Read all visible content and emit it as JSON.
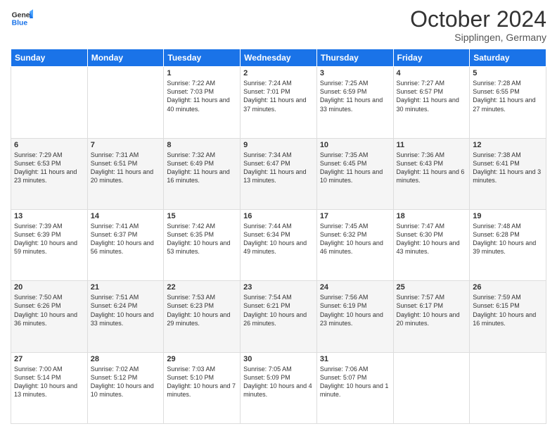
{
  "header": {
    "logo_general": "General",
    "logo_blue": "Blue",
    "month": "October 2024",
    "location": "Sipplingen, Germany"
  },
  "days_of_week": [
    "Sunday",
    "Monday",
    "Tuesday",
    "Wednesday",
    "Thursday",
    "Friday",
    "Saturday"
  ],
  "weeks": [
    [
      {
        "day": "",
        "sunrise": "",
        "sunset": "",
        "daylight": ""
      },
      {
        "day": "",
        "sunrise": "",
        "sunset": "",
        "daylight": ""
      },
      {
        "day": "1",
        "sunrise": "Sunrise: 7:22 AM",
        "sunset": "Sunset: 7:03 PM",
        "daylight": "Daylight: 11 hours and 40 minutes."
      },
      {
        "day": "2",
        "sunrise": "Sunrise: 7:24 AM",
        "sunset": "Sunset: 7:01 PM",
        "daylight": "Daylight: 11 hours and 37 minutes."
      },
      {
        "day": "3",
        "sunrise": "Sunrise: 7:25 AM",
        "sunset": "Sunset: 6:59 PM",
        "daylight": "Daylight: 11 hours and 33 minutes."
      },
      {
        "day": "4",
        "sunrise": "Sunrise: 7:27 AM",
        "sunset": "Sunset: 6:57 PM",
        "daylight": "Daylight: 11 hours and 30 minutes."
      },
      {
        "day": "5",
        "sunrise": "Sunrise: 7:28 AM",
        "sunset": "Sunset: 6:55 PM",
        "daylight": "Daylight: 11 hours and 27 minutes."
      }
    ],
    [
      {
        "day": "6",
        "sunrise": "Sunrise: 7:29 AM",
        "sunset": "Sunset: 6:53 PM",
        "daylight": "Daylight: 11 hours and 23 minutes."
      },
      {
        "day": "7",
        "sunrise": "Sunrise: 7:31 AM",
        "sunset": "Sunset: 6:51 PM",
        "daylight": "Daylight: 11 hours and 20 minutes."
      },
      {
        "day": "8",
        "sunrise": "Sunrise: 7:32 AM",
        "sunset": "Sunset: 6:49 PM",
        "daylight": "Daylight: 11 hours and 16 minutes."
      },
      {
        "day": "9",
        "sunrise": "Sunrise: 7:34 AM",
        "sunset": "Sunset: 6:47 PM",
        "daylight": "Daylight: 11 hours and 13 minutes."
      },
      {
        "day": "10",
        "sunrise": "Sunrise: 7:35 AM",
        "sunset": "Sunset: 6:45 PM",
        "daylight": "Daylight: 11 hours and 10 minutes."
      },
      {
        "day": "11",
        "sunrise": "Sunrise: 7:36 AM",
        "sunset": "Sunset: 6:43 PM",
        "daylight": "Daylight: 11 hours and 6 minutes."
      },
      {
        "day": "12",
        "sunrise": "Sunrise: 7:38 AM",
        "sunset": "Sunset: 6:41 PM",
        "daylight": "Daylight: 11 hours and 3 minutes."
      }
    ],
    [
      {
        "day": "13",
        "sunrise": "Sunrise: 7:39 AM",
        "sunset": "Sunset: 6:39 PM",
        "daylight": "Daylight: 10 hours and 59 minutes."
      },
      {
        "day": "14",
        "sunrise": "Sunrise: 7:41 AM",
        "sunset": "Sunset: 6:37 PM",
        "daylight": "Daylight: 10 hours and 56 minutes."
      },
      {
        "day": "15",
        "sunrise": "Sunrise: 7:42 AM",
        "sunset": "Sunset: 6:35 PM",
        "daylight": "Daylight: 10 hours and 53 minutes."
      },
      {
        "day": "16",
        "sunrise": "Sunrise: 7:44 AM",
        "sunset": "Sunset: 6:34 PM",
        "daylight": "Daylight: 10 hours and 49 minutes."
      },
      {
        "day": "17",
        "sunrise": "Sunrise: 7:45 AM",
        "sunset": "Sunset: 6:32 PM",
        "daylight": "Daylight: 10 hours and 46 minutes."
      },
      {
        "day": "18",
        "sunrise": "Sunrise: 7:47 AM",
        "sunset": "Sunset: 6:30 PM",
        "daylight": "Daylight: 10 hours and 43 minutes."
      },
      {
        "day": "19",
        "sunrise": "Sunrise: 7:48 AM",
        "sunset": "Sunset: 6:28 PM",
        "daylight": "Daylight: 10 hours and 39 minutes."
      }
    ],
    [
      {
        "day": "20",
        "sunrise": "Sunrise: 7:50 AM",
        "sunset": "Sunset: 6:26 PM",
        "daylight": "Daylight: 10 hours and 36 minutes."
      },
      {
        "day": "21",
        "sunrise": "Sunrise: 7:51 AM",
        "sunset": "Sunset: 6:24 PM",
        "daylight": "Daylight: 10 hours and 33 minutes."
      },
      {
        "day": "22",
        "sunrise": "Sunrise: 7:53 AM",
        "sunset": "Sunset: 6:23 PM",
        "daylight": "Daylight: 10 hours and 29 minutes."
      },
      {
        "day": "23",
        "sunrise": "Sunrise: 7:54 AM",
        "sunset": "Sunset: 6:21 PM",
        "daylight": "Daylight: 10 hours and 26 minutes."
      },
      {
        "day": "24",
        "sunrise": "Sunrise: 7:56 AM",
        "sunset": "Sunset: 6:19 PM",
        "daylight": "Daylight: 10 hours and 23 minutes."
      },
      {
        "day": "25",
        "sunrise": "Sunrise: 7:57 AM",
        "sunset": "Sunset: 6:17 PM",
        "daylight": "Daylight: 10 hours and 20 minutes."
      },
      {
        "day": "26",
        "sunrise": "Sunrise: 7:59 AM",
        "sunset": "Sunset: 6:15 PM",
        "daylight": "Daylight: 10 hours and 16 minutes."
      }
    ],
    [
      {
        "day": "27",
        "sunrise": "Sunrise: 7:00 AM",
        "sunset": "Sunset: 5:14 PM",
        "daylight": "Daylight: 10 hours and 13 minutes."
      },
      {
        "day": "28",
        "sunrise": "Sunrise: 7:02 AM",
        "sunset": "Sunset: 5:12 PM",
        "daylight": "Daylight: 10 hours and 10 minutes."
      },
      {
        "day": "29",
        "sunrise": "Sunrise: 7:03 AM",
        "sunset": "Sunset: 5:10 PM",
        "daylight": "Daylight: 10 hours and 7 minutes."
      },
      {
        "day": "30",
        "sunrise": "Sunrise: 7:05 AM",
        "sunset": "Sunset: 5:09 PM",
        "daylight": "Daylight: 10 hours and 4 minutes."
      },
      {
        "day": "31",
        "sunrise": "Sunrise: 7:06 AM",
        "sunset": "Sunset: 5:07 PM",
        "daylight": "Daylight: 10 hours and 1 minute."
      },
      {
        "day": "",
        "sunrise": "",
        "sunset": "",
        "daylight": ""
      },
      {
        "day": "",
        "sunrise": "",
        "sunset": "",
        "daylight": ""
      }
    ]
  ]
}
